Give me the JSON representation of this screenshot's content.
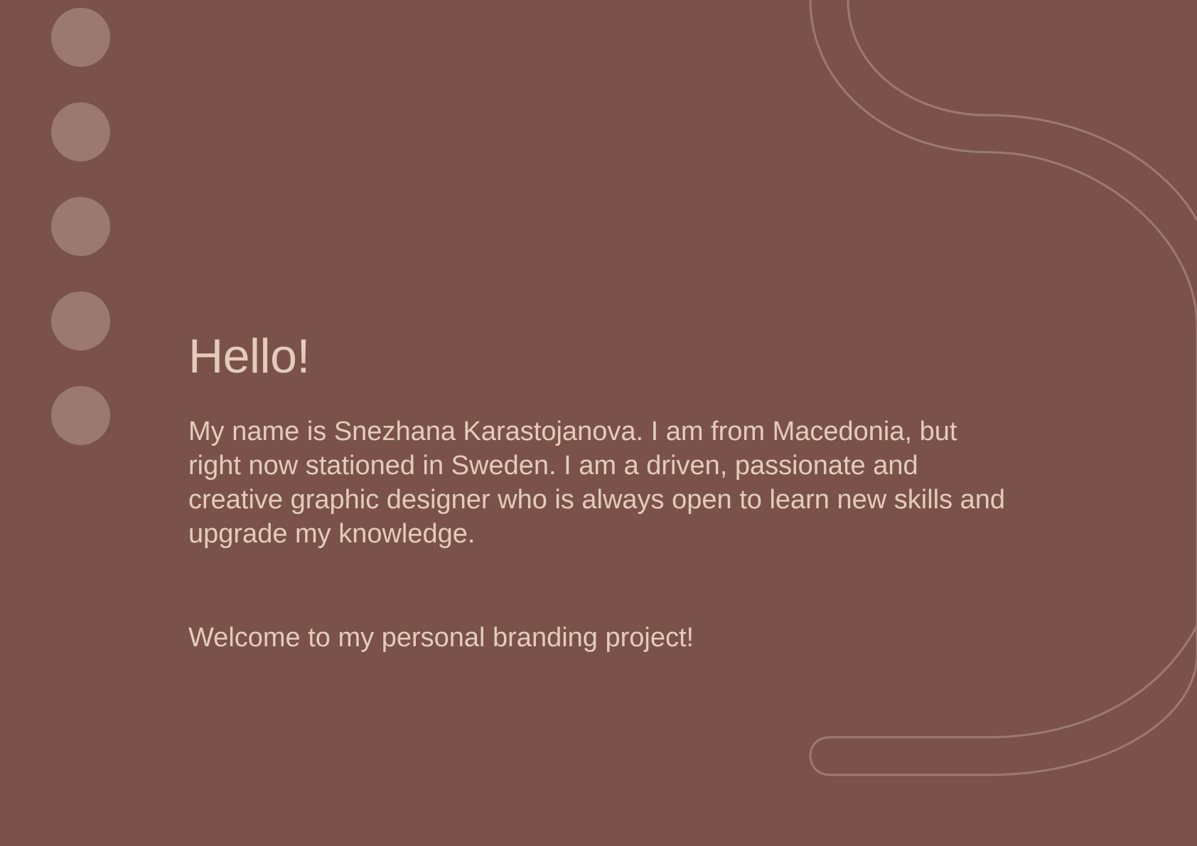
{
  "theme": {
    "background": "#7a524b",
    "text": "#e4cbbd",
    "dot": "#9b7970",
    "line": "#9d7a71"
  },
  "dots": [
    {
      "icon": "circle-dot-icon"
    },
    {
      "icon": "circle-dot-icon"
    },
    {
      "icon": "circle-dot-icon"
    },
    {
      "icon": "circle-dot-icon"
    },
    {
      "icon": "circle-dot-icon"
    }
  ],
  "content": {
    "greeting": "Hello!",
    "bio": "My name is Snezhana Karastojanova. I am from Macedonia, but right now stationed in Sweden. I am a driven, passionate and creative graphic designer who is always open to learn new skills and upgrade my knowledge.",
    "welcome": "Welcome to my personal branding project!"
  }
}
